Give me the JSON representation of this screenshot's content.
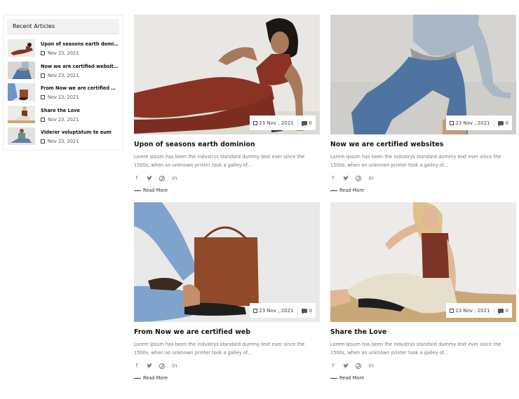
{
  "sidebar": {
    "heading": "Recent Articles",
    "items": [
      {
        "title": "Upon of seasons earth dominion",
        "date": "Nov 23, 2021"
      },
      {
        "title": "Now we are certified websites",
        "date": "Nov 23, 2021"
      },
      {
        "title": "From Now we are certified web",
        "date": "Nov 23, 2021"
      },
      {
        "title": "Share the Love",
        "date": "Nov 23, 2021"
      },
      {
        "title": "Viderer voluptatum te eum",
        "date": "Nov 23, 2021"
      }
    ]
  },
  "cards": [
    {
      "title": "Upon of seasons earth dominion",
      "date": "23 Nov , 2021",
      "comments": "0",
      "excerpt": "Lorem Ipsum has been the industrys standard dummy text ever since the 1500s, when an unknown printer took a galley of...",
      "read_more": "Read More"
    },
    {
      "title": "Now we are certified websites",
      "date": "23 Nov , 2021",
      "comments": "0",
      "excerpt": "Lorem Ipsum has been the industrys standard dummy text ever since the 1500s, when an unknown printer took a galley of...",
      "read_more": "Read More"
    },
    {
      "title": "From Now we are certified web",
      "date": "23 Nov , 2021",
      "comments": "0",
      "excerpt": "Lorem Ipsum has been the industrys standard dummy text ever since the 1500s, when an unknown printer took a galley of...",
      "read_more": "Read More"
    },
    {
      "title": "Share the Love",
      "date": "23 Nov , 2021",
      "comments": "0",
      "excerpt": "Lorem Ipsum has been the industrys standard dummy text ever since the 1500s, when an unknown printer took a galley of...",
      "read_more": "Read More"
    }
  ],
  "social_icons": [
    "facebook-icon",
    "twitter-icon",
    "pinterest-icon",
    "linkedin-icon"
  ],
  "colors": {
    "accent_rust": "#8a3324",
    "denim": "#5a7fa8",
    "text_dark": "#111111",
    "text_muted": "#777777"
  }
}
